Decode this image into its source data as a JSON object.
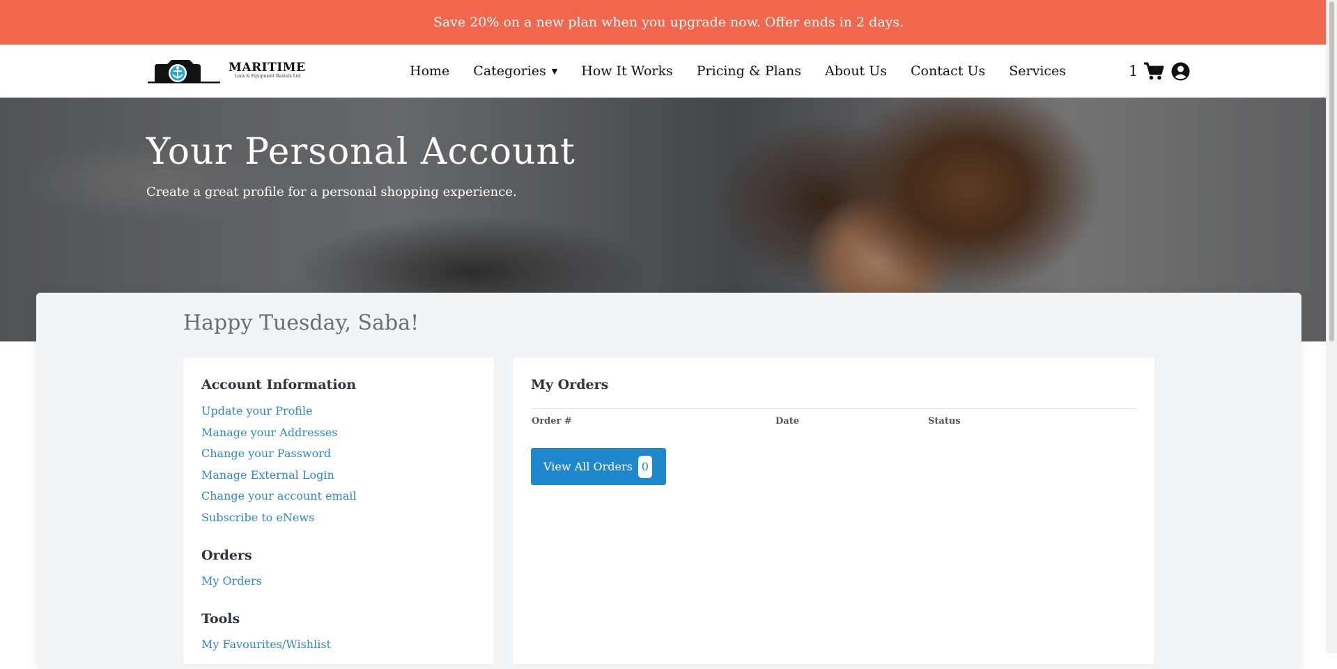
{
  "promo": {
    "text": "Save 20% on a new plan when you upgrade now. Offer ends in 2 days."
  },
  "brand": {
    "name": "MARITIME",
    "tagline": "Lens & Equipment Rentals Ltd."
  },
  "nav": {
    "items": [
      "Home",
      "Categories",
      "How It Works",
      "Pricing & Plans",
      "About Us",
      "Contact Us",
      "Services"
    ]
  },
  "cart": {
    "count": "1",
    "icon": "cart-icon",
    "user_icon": "user-circle-icon"
  },
  "hero": {
    "title": "Your Personal Account",
    "subtitle": "Create a great profile for a personal shopping experience."
  },
  "greeting": "Happy Tuesday, Saba!",
  "account": {
    "title": "Account Information",
    "links": [
      "Update your Profile",
      "Manage your Addresses",
      "Change your Password",
      "Manage External Login",
      "Change your account email",
      "Subscribe to eNews"
    ],
    "orders_title": "Orders",
    "orders_links": [
      "My Orders"
    ],
    "tools_title": "Tools",
    "tools_links": [
      "My Favourites/Wishlist"
    ]
  },
  "orders": {
    "title": "My Orders",
    "columns": [
      "Order #",
      "Date",
      "Status"
    ],
    "button_label": "View All Orders",
    "button_count": "0"
  },
  "colors": {
    "promo_bg": "#f0674d",
    "link": "#2e86c9",
    "button": "#1f87cc"
  }
}
